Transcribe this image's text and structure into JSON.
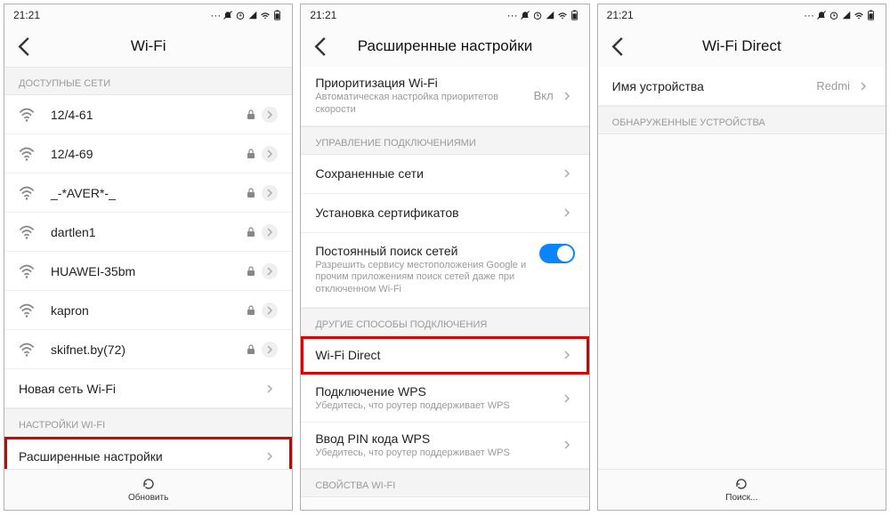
{
  "status": {
    "time": "21:21"
  },
  "screen1": {
    "title": "Wi-Fi",
    "section_networks": "ДОСТУПНЫЕ СЕТИ",
    "networks": [
      {
        "ssid": "12/4-61",
        "locked": true
      },
      {
        "ssid": "12/4-69",
        "locked": true
      },
      {
        "ssid": "_-*AVER*-_",
        "locked": true
      },
      {
        "ssid": "dartlen1",
        "locked": true
      },
      {
        "ssid": "HUAWEI-35bm",
        "locked": true
      },
      {
        "ssid": "kapron",
        "locked": true
      },
      {
        "ssid": "skifnet.by(72)",
        "locked": true
      }
    ],
    "new_network": "Новая сеть Wi-Fi",
    "section_settings": "НАСТРОЙКИ WI-FI",
    "advanced": "Расширенные настройки",
    "footer": "Обновить"
  },
  "screen2": {
    "title": "Расширенные настройки",
    "priority": {
      "label": "Приоритизация Wi-Fi",
      "sub": "Автоматическая настройка приоритетов скорости",
      "value": "Вкл"
    },
    "section_conn": "УПРАВЛЕНИЕ ПОДКЛЮЧЕНИЯМИ",
    "saved": "Сохраненные сети",
    "certs": "Установка сертификатов",
    "scan": {
      "label": "Постоянный поиск сетей",
      "sub": "Разрешить сервису местоположения Google и прочим приложениям поиск сетей даже при отключенном Wi-Fi"
    },
    "section_other": "ДРУГИЕ СПОСОБЫ ПОДКЛЮЧЕНИЯ",
    "direct": "Wi-Fi Direct",
    "wps": {
      "label": "Подключение WPS",
      "sub": "Убедитесь, что роутер поддерживает WPS"
    },
    "wps_pin": {
      "label": "Ввод PIN кода WPS",
      "sub": "Убедитесь, что роутер поддерживает WPS"
    },
    "section_props": "СВОЙСТВА WI-FI"
  },
  "screen3": {
    "title": "Wi-Fi Direct",
    "device": {
      "label": "Имя устройства",
      "value": "Redmi"
    },
    "section_found": "ОБНАРУЖЕННЫЕ УСТРОЙСТВА",
    "footer": "Поиск..."
  }
}
